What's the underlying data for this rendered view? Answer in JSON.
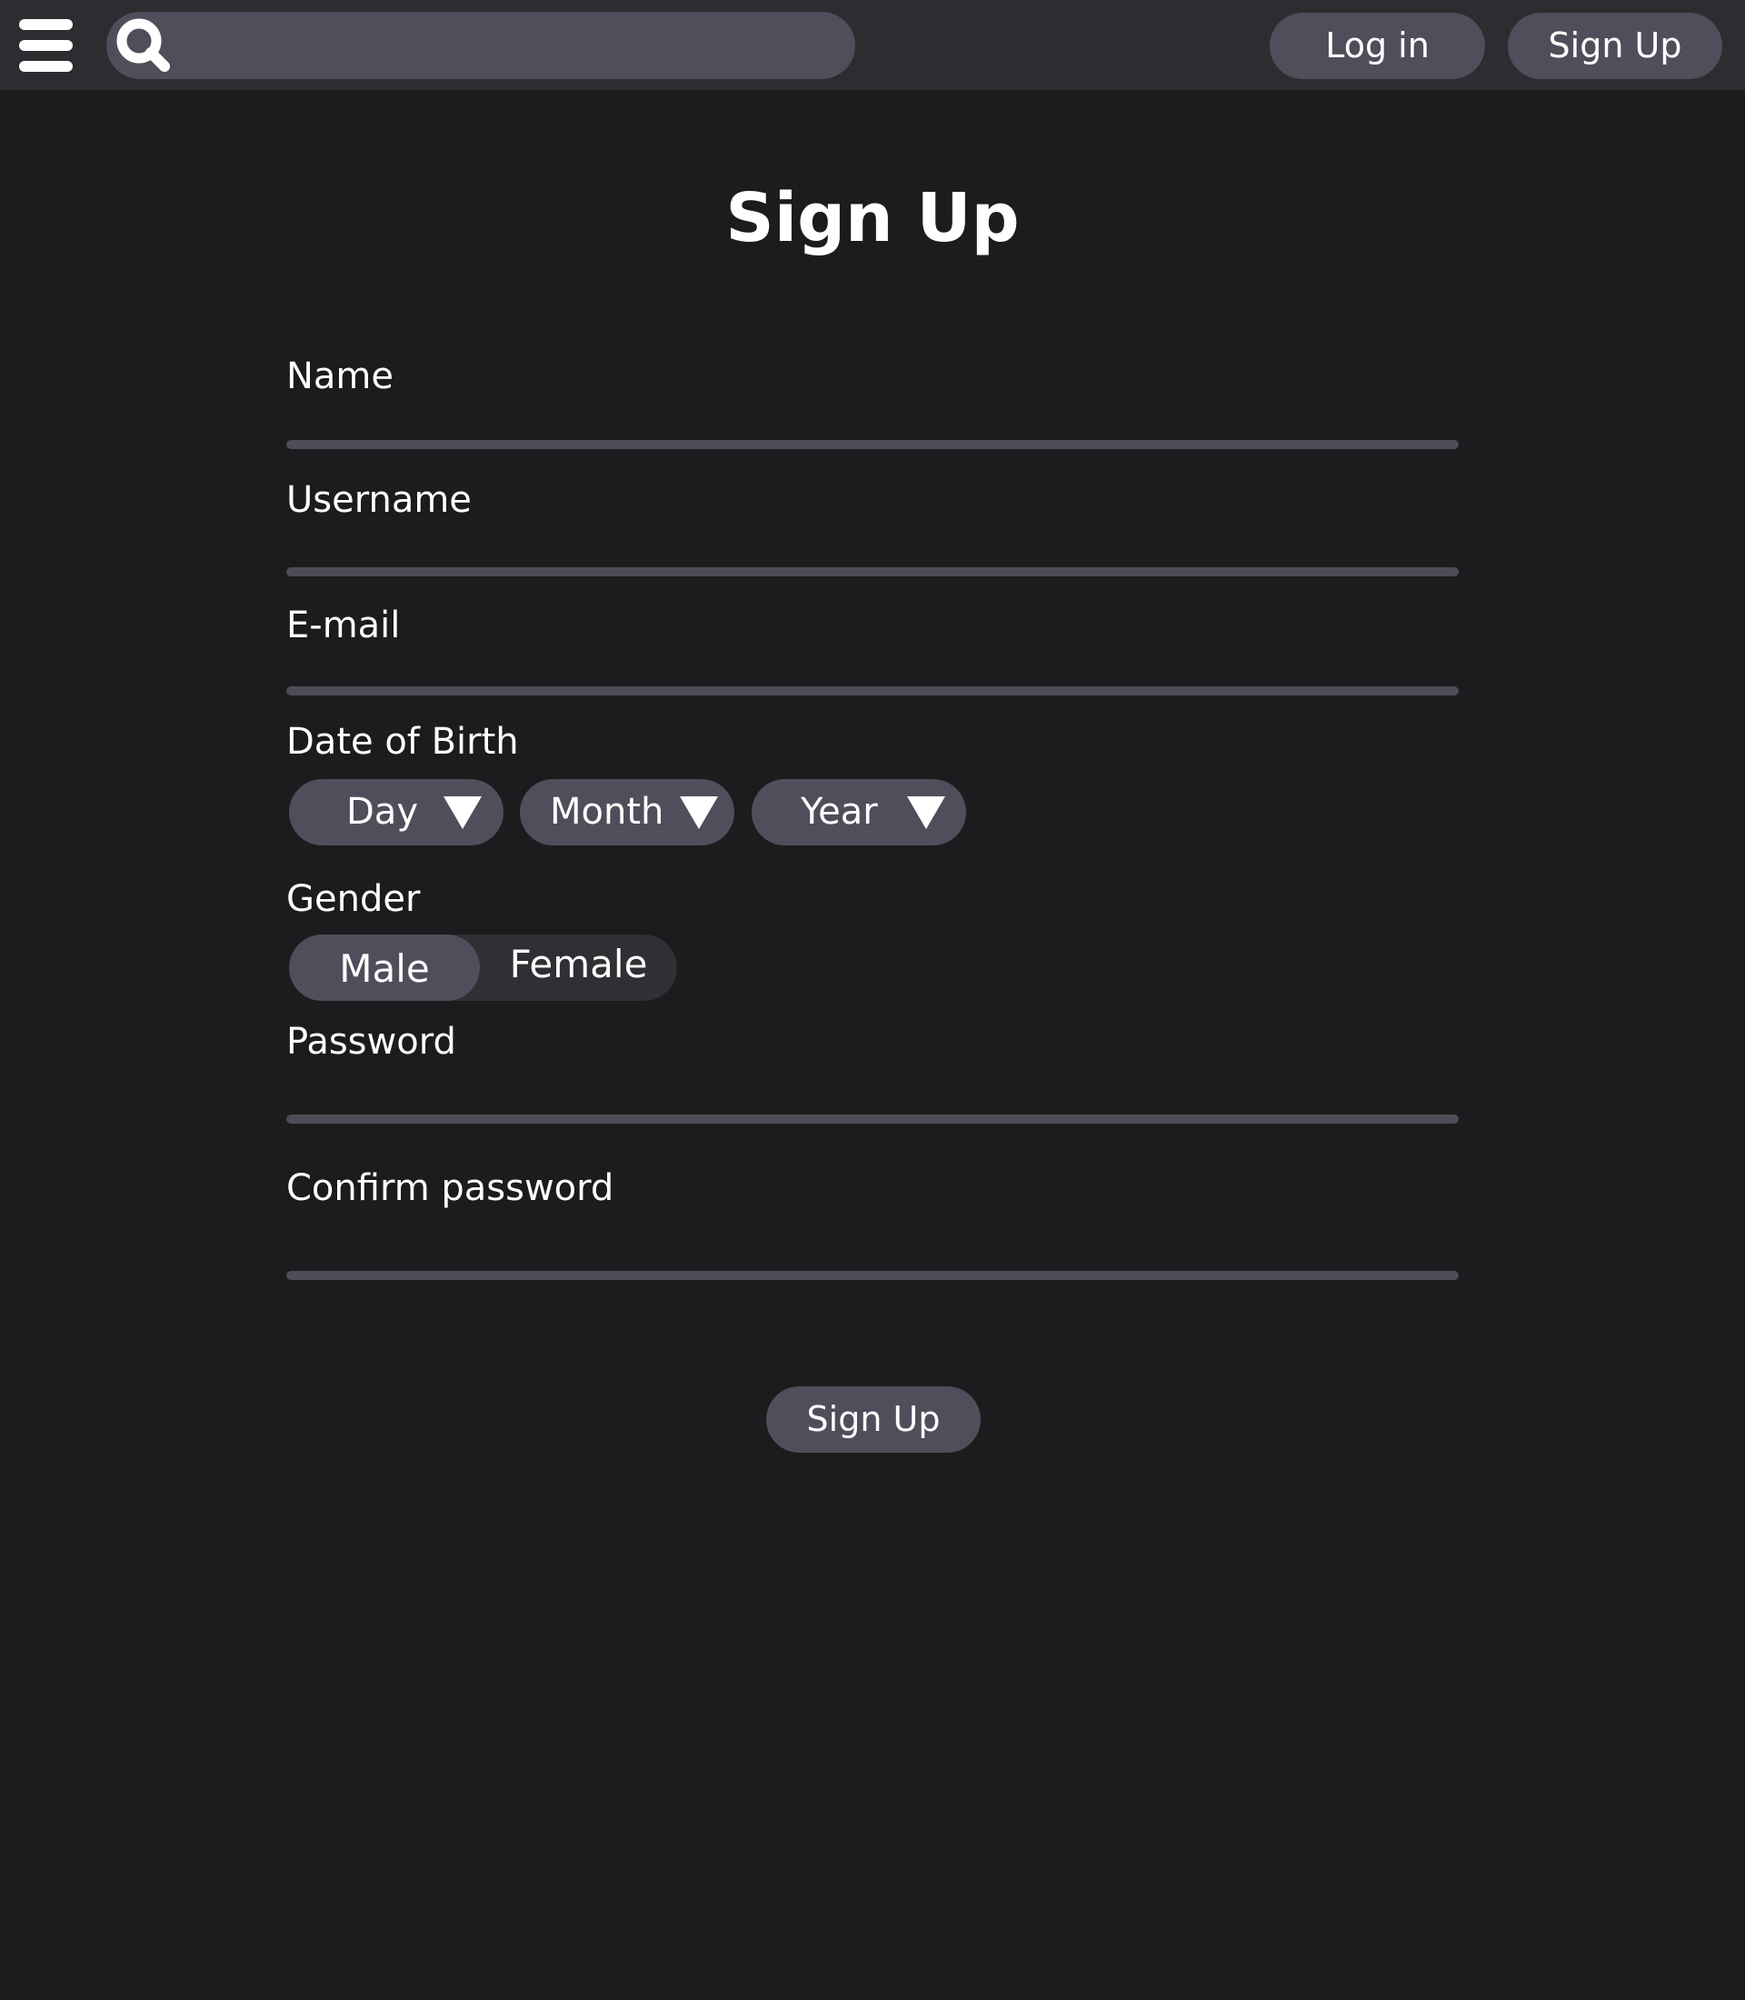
{
  "topbar": {
    "menu_icon": "hamburger-menu-icon",
    "search_icon": "search-icon",
    "search_placeholder": "",
    "login_label": "Log in",
    "signup_label": "Sign Up"
  },
  "form": {
    "title": "Sign Up",
    "name_label": "Name",
    "username_label": "Username",
    "email_label": "E-mail",
    "dob_label": "Date of Birth",
    "day_label": "Day",
    "month_label": "Month",
    "year_label": "Year",
    "caret_icon": "caret-down-icon",
    "gender_label": "Gender",
    "gender_options": [
      "Male",
      "Female"
    ],
    "gender_selected": "Male",
    "password_label": "Password",
    "confirm_password_label": "Confirm password",
    "submit_label": "Sign Up"
  },
  "colors": {
    "background": "#1c1c1e",
    "topbar": "#2c2c31",
    "pill": "#4f4f5b",
    "underline": "#4d4d58",
    "text": "#ffffff"
  }
}
